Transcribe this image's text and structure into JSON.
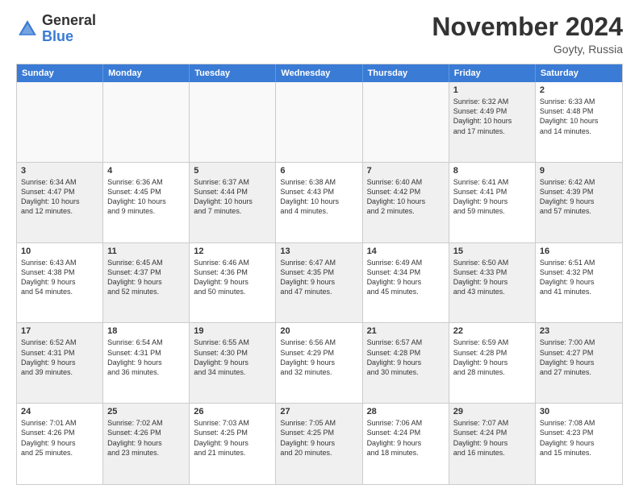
{
  "header": {
    "logo_general": "General",
    "logo_blue": "Blue",
    "month_title": "November 2024",
    "location": "Goyty, Russia"
  },
  "days_of_week": [
    "Sunday",
    "Monday",
    "Tuesday",
    "Wednesday",
    "Thursday",
    "Friday",
    "Saturday"
  ],
  "rows": [
    [
      {
        "day": "",
        "empty": true
      },
      {
        "day": "",
        "empty": true
      },
      {
        "day": "",
        "empty": true
      },
      {
        "day": "",
        "empty": true
      },
      {
        "day": "",
        "empty": true
      },
      {
        "day": "1",
        "shaded": true,
        "lines": [
          "Sunrise: 6:32 AM",
          "Sunset: 4:49 PM",
          "Daylight: 10 hours",
          "and 17 minutes."
        ]
      },
      {
        "day": "2",
        "shaded": false,
        "lines": [
          "Sunrise: 6:33 AM",
          "Sunset: 4:48 PM",
          "Daylight: 10 hours",
          "and 14 minutes."
        ]
      }
    ],
    [
      {
        "day": "3",
        "shaded": true,
        "lines": [
          "Sunrise: 6:34 AM",
          "Sunset: 4:47 PM",
          "Daylight: 10 hours",
          "and 12 minutes."
        ]
      },
      {
        "day": "4",
        "shaded": false,
        "lines": [
          "Sunrise: 6:36 AM",
          "Sunset: 4:45 PM",
          "Daylight: 10 hours",
          "and 9 minutes."
        ]
      },
      {
        "day": "5",
        "shaded": true,
        "lines": [
          "Sunrise: 6:37 AM",
          "Sunset: 4:44 PM",
          "Daylight: 10 hours",
          "and 7 minutes."
        ]
      },
      {
        "day": "6",
        "shaded": false,
        "lines": [
          "Sunrise: 6:38 AM",
          "Sunset: 4:43 PM",
          "Daylight: 10 hours",
          "and 4 minutes."
        ]
      },
      {
        "day": "7",
        "shaded": true,
        "lines": [
          "Sunrise: 6:40 AM",
          "Sunset: 4:42 PM",
          "Daylight: 10 hours",
          "and 2 minutes."
        ]
      },
      {
        "day": "8",
        "shaded": false,
        "lines": [
          "Sunrise: 6:41 AM",
          "Sunset: 4:41 PM",
          "Daylight: 9 hours",
          "and 59 minutes."
        ]
      },
      {
        "day": "9",
        "shaded": true,
        "lines": [
          "Sunrise: 6:42 AM",
          "Sunset: 4:39 PM",
          "Daylight: 9 hours",
          "and 57 minutes."
        ]
      }
    ],
    [
      {
        "day": "10",
        "shaded": false,
        "lines": [
          "Sunrise: 6:43 AM",
          "Sunset: 4:38 PM",
          "Daylight: 9 hours",
          "and 54 minutes."
        ]
      },
      {
        "day": "11",
        "shaded": true,
        "lines": [
          "Sunrise: 6:45 AM",
          "Sunset: 4:37 PM",
          "Daylight: 9 hours",
          "and 52 minutes."
        ]
      },
      {
        "day": "12",
        "shaded": false,
        "lines": [
          "Sunrise: 6:46 AM",
          "Sunset: 4:36 PM",
          "Daylight: 9 hours",
          "and 50 minutes."
        ]
      },
      {
        "day": "13",
        "shaded": true,
        "lines": [
          "Sunrise: 6:47 AM",
          "Sunset: 4:35 PM",
          "Daylight: 9 hours",
          "and 47 minutes."
        ]
      },
      {
        "day": "14",
        "shaded": false,
        "lines": [
          "Sunrise: 6:49 AM",
          "Sunset: 4:34 PM",
          "Daylight: 9 hours",
          "and 45 minutes."
        ]
      },
      {
        "day": "15",
        "shaded": true,
        "lines": [
          "Sunrise: 6:50 AM",
          "Sunset: 4:33 PM",
          "Daylight: 9 hours",
          "and 43 minutes."
        ]
      },
      {
        "day": "16",
        "shaded": false,
        "lines": [
          "Sunrise: 6:51 AM",
          "Sunset: 4:32 PM",
          "Daylight: 9 hours",
          "and 41 minutes."
        ]
      }
    ],
    [
      {
        "day": "17",
        "shaded": true,
        "lines": [
          "Sunrise: 6:52 AM",
          "Sunset: 4:31 PM",
          "Daylight: 9 hours",
          "and 39 minutes."
        ]
      },
      {
        "day": "18",
        "shaded": false,
        "lines": [
          "Sunrise: 6:54 AM",
          "Sunset: 4:31 PM",
          "Daylight: 9 hours",
          "and 36 minutes."
        ]
      },
      {
        "day": "19",
        "shaded": true,
        "lines": [
          "Sunrise: 6:55 AM",
          "Sunset: 4:30 PM",
          "Daylight: 9 hours",
          "and 34 minutes."
        ]
      },
      {
        "day": "20",
        "shaded": false,
        "lines": [
          "Sunrise: 6:56 AM",
          "Sunset: 4:29 PM",
          "Daylight: 9 hours",
          "and 32 minutes."
        ]
      },
      {
        "day": "21",
        "shaded": true,
        "lines": [
          "Sunrise: 6:57 AM",
          "Sunset: 4:28 PM",
          "Daylight: 9 hours",
          "and 30 minutes."
        ]
      },
      {
        "day": "22",
        "shaded": false,
        "lines": [
          "Sunrise: 6:59 AM",
          "Sunset: 4:28 PM",
          "Daylight: 9 hours",
          "and 28 minutes."
        ]
      },
      {
        "day": "23",
        "shaded": true,
        "lines": [
          "Sunrise: 7:00 AM",
          "Sunset: 4:27 PM",
          "Daylight: 9 hours",
          "and 27 minutes."
        ]
      }
    ],
    [
      {
        "day": "24",
        "shaded": false,
        "lines": [
          "Sunrise: 7:01 AM",
          "Sunset: 4:26 PM",
          "Daylight: 9 hours",
          "and 25 minutes."
        ]
      },
      {
        "day": "25",
        "shaded": true,
        "lines": [
          "Sunrise: 7:02 AM",
          "Sunset: 4:26 PM",
          "Daylight: 9 hours",
          "and 23 minutes."
        ]
      },
      {
        "day": "26",
        "shaded": false,
        "lines": [
          "Sunrise: 7:03 AM",
          "Sunset: 4:25 PM",
          "Daylight: 9 hours",
          "and 21 minutes."
        ]
      },
      {
        "day": "27",
        "shaded": true,
        "lines": [
          "Sunrise: 7:05 AM",
          "Sunset: 4:25 PM",
          "Daylight: 9 hours",
          "and 20 minutes."
        ]
      },
      {
        "day": "28",
        "shaded": false,
        "lines": [
          "Sunrise: 7:06 AM",
          "Sunset: 4:24 PM",
          "Daylight: 9 hours",
          "and 18 minutes."
        ]
      },
      {
        "day": "29",
        "shaded": true,
        "lines": [
          "Sunrise: 7:07 AM",
          "Sunset: 4:24 PM",
          "Daylight: 9 hours",
          "and 16 minutes."
        ]
      },
      {
        "day": "30",
        "shaded": false,
        "lines": [
          "Sunrise: 7:08 AM",
          "Sunset: 4:23 PM",
          "Daylight: 9 hours",
          "and 15 minutes."
        ]
      }
    ]
  ]
}
